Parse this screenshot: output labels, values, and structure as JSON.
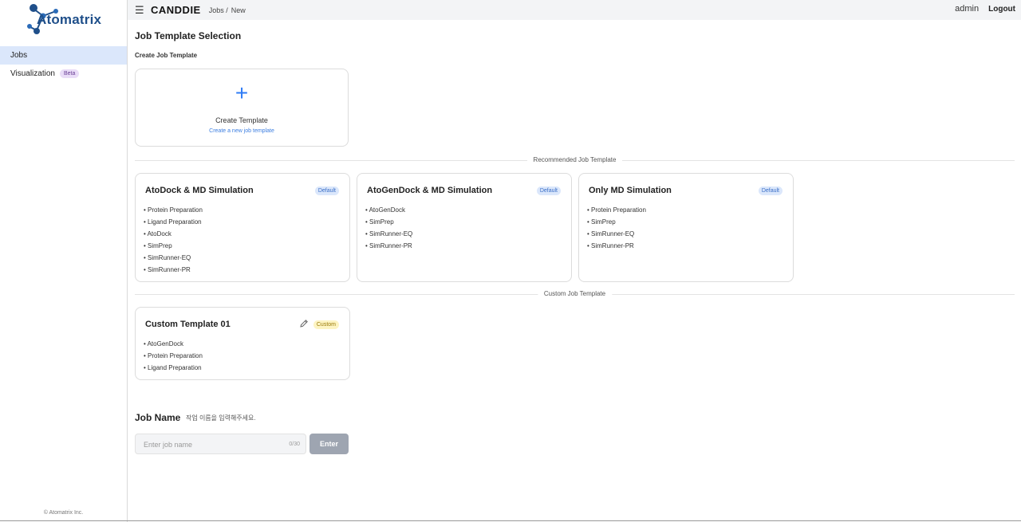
{
  "brand": {
    "logo_text": "Atomatrix",
    "logo_icon": "atom-molecule-icon",
    "accent": "#1f4f8a"
  },
  "sidebar": {
    "items": [
      {
        "label": "Jobs",
        "active": true
      },
      {
        "label": "Visualization",
        "badge": "Beta",
        "active": false
      }
    ],
    "copyright": "© Atomatrix Inc."
  },
  "topbar": {
    "menu_icon": "☰",
    "app_name": "CANDDIE",
    "breadcrumbs": [
      "Jobs /",
      "New"
    ],
    "user": "admin",
    "logout": "Logout"
  },
  "main": {
    "title": "Job Template Selection",
    "create_section_label": "Create Job Template",
    "create_card": {
      "icon": "+",
      "title": "Create Template",
      "subtitle": "Create a new job template"
    },
    "recommended_label": "Recommended Job Template",
    "recommended": [
      {
        "title": "AtoDock & MD Simulation",
        "badge": "Default",
        "steps": [
          "• Protein Preparation",
          "• Ligand Preparation",
          "• AtoDock",
          "• SimPrep",
          "• SimRunner-EQ",
          "• SimRunner-PR"
        ]
      },
      {
        "title": "AtoGenDock & MD Simulation",
        "badge": "Default",
        "steps": [
          "• AtoGenDock",
          "• SimPrep",
          "• SimRunner-EQ",
          "• SimRunner-PR"
        ]
      },
      {
        "title": "Only MD Simulation",
        "badge": "Default",
        "steps": [
          "• Protein Preparation",
          "• SimPrep",
          "• SimRunner-EQ",
          "• SimRunner-PR"
        ]
      }
    ],
    "custom_label": "Custom Job Template",
    "custom": [
      {
        "title": "Custom Template 01",
        "badge": "Custom",
        "steps": [
          "• AtoGenDock",
          "• Protein Preparation",
          "• Ligand Preparation"
        ]
      }
    ],
    "job_name": {
      "label": "Job Name",
      "hint": "작업 이름을 입력해주세요.",
      "placeholder": "Enter job name",
      "counter": "0/30",
      "button": "Enter"
    }
  },
  "colors": {
    "active_nav": "#dbe7fb",
    "plus": "#2f7cf6",
    "default_badge": "#dbe7fb",
    "custom_badge": "#fdf4c2",
    "enter_button": "#9ea5b1"
  }
}
